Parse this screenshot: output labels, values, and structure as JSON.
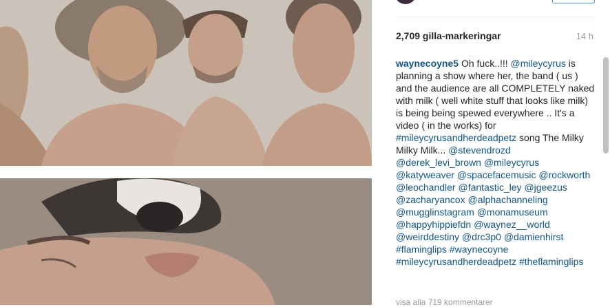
{
  "post": {
    "likes": "2,709 gilla-markeringar",
    "time": "14 h",
    "username": "waynecoyne5",
    "caption_parts": [
      {
        "t": "text",
        "v": " Oh fuck..!!! "
      },
      {
        "t": "tag",
        "v": "@mileycyrus"
      },
      {
        "t": "text",
        "v": " is planning a show where her, the band ( us ) and the audience are all COMPLETELY naked with milk ( well white stuff that looks like milk) is being being spewed everywhere .. It's a video ( in the works) for "
      },
      {
        "t": "tag",
        "v": "#mileycyrusandherdeadpetz"
      },
      {
        "t": "text",
        "v": " song The Milky Milky Milk... "
      },
      {
        "t": "tag",
        "v": "@stevendrozd"
      },
      {
        "t": "text",
        "v": " "
      },
      {
        "t": "tag",
        "v": "@derek_levi_brown"
      },
      {
        "t": "text",
        "v": " "
      },
      {
        "t": "tag",
        "v": "@mileycyrus"
      },
      {
        "t": "text",
        "v": " "
      },
      {
        "t": "tag",
        "v": "@katyweaver"
      },
      {
        "t": "text",
        "v": " "
      },
      {
        "t": "tag",
        "v": "@spacefacemusic"
      },
      {
        "t": "text",
        "v": " "
      },
      {
        "t": "tag",
        "v": "@rockworth"
      },
      {
        "t": "text",
        "v": " "
      },
      {
        "t": "tag",
        "v": "@leochandler"
      },
      {
        "t": "text",
        "v": " "
      },
      {
        "t": "tag",
        "v": "@fantastic_ley"
      },
      {
        "t": "text",
        "v": " "
      },
      {
        "t": "tag",
        "v": "@jgeezus"
      },
      {
        "t": "text",
        "v": " "
      },
      {
        "t": "tag",
        "v": "@zacharyancox"
      },
      {
        "t": "text",
        "v": " "
      },
      {
        "t": "tag",
        "v": "@alphachanneling"
      },
      {
        "t": "text",
        "v": " "
      },
      {
        "t": "tag",
        "v": "@mugglinstagram"
      },
      {
        "t": "text",
        "v": " "
      },
      {
        "t": "tag",
        "v": "@monamuseum"
      },
      {
        "t": "text",
        "v": " "
      },
      {
        "t": "tag",
        "v": "@happyhippiefdn"
      },
      {
        "t": "text",
        "v": " "
      },
      {
        "t": "tag",
        "v": "@waynez__world"
      },
      {
        "t": "text",
        "v": " "
      },
      {
        "t": "tag",
        "v": "@weirddestiny"
      },
      {
        "t": "text",
        "v": " "
      },
      {
        "t": "tag",
        "v": "@drc3p0"
      },
      {
        "t": "text",
        "v": " "
      },
      {
        "t": "tag",
        "v": "@damienhirst"
      },
      {
        "t": "text",
        "v": " "
      },
      {
        "t": "tag",
        "v": "#flaminglips"
      },
      {
        "t": "text",
        "v": " "
      },
      {
        "t": "tag",
        "v": "#waynecoyne"
      },
      {
        "t": "text",
        "v": " "
      },
      {
        "t": "tag",
        "v": "#mileycyrusandherdeadpetz"
      },
      {
        "t": "text",
        "v": " "
      },
      {
        "t": "tag",
        "v": "#theflaminglips"
      }
    ],
    "view_all_comments": "visa alla 719 kommentarer"
  },
  "colors": {
    "link": "#125688",
    "text": "#262626",
    "muted": "#a0a0a0"
  },
  "icons": {
    "avatar": "avatar",
    "photo_top": "band-photo",
    "photo_bottom": "dog-and-face-photo"
  }
}
